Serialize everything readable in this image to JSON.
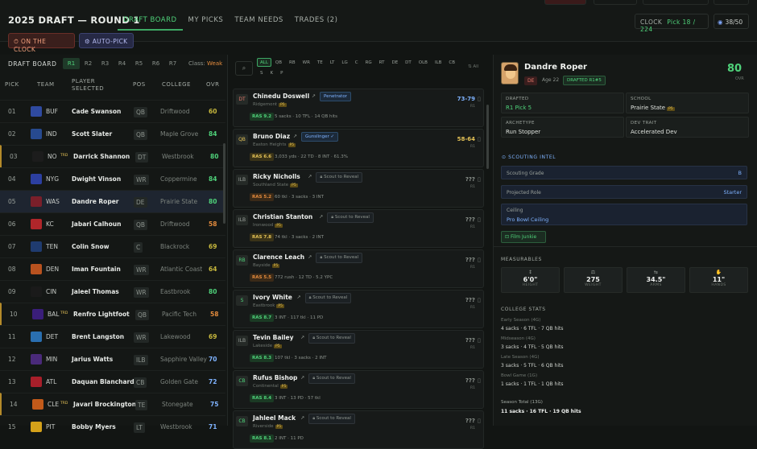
{
  "header": {
    "title": "2025 DRAFT — ROUND 1",
    "tabs": [
      {
        "label": "DRAFT BOARD",
        "active": true
      },
      {
        "label": "MY PICKS",
        "active": false
      },
      {
        "label": "TEAM NEEDS",
        "active": false
      },
      {
        "label": "TRADES (2)",
        "active": false
      }
    ],
    "clock_label": "CLOCK",
    "clock_value": "Pick 18 / 224",
    "presence": "38/50"
  },
  "actions": {
    "on_clock": "ON THE CLOCK",
    "auto_pick": "AUTO-PICK"
  },
  "board": {
    "title": "DRAFT BOARD",
    "rounds": [
      "R1",
      "R2",
      "R3",
      "R4",
      "R5",
      "R6",
      "R7"
    ],
    "active_round": "R1",
    "class_label": "Class:",
    "class_value": "Weak",
    "columns": {
      "pick": "PICK",
      "team": "TEAM",
      "player": "PLAYER\nSELECTED",
      "pos": "POS",
      "college": "COLLEGE",
      "ovr": "OVR"
    },
    "rows": [
      {
        "pick": "01",
        "team": "BUF",
        "logo_color": "#2f4aa0",
        "player": "Cade Swanson",
        "pos": "QB",
        "college": "Driftwood",
        "ovr": "60",
        "ovr_color": "#c7b83d"
      },
      {
        "pick": "02",
        "team": "IND",
        "logo_color": "#274a8f",
        "player": "Scott Slater",
        "pos": "QB",
        "college": "Maple Grove",
        "ovr": "84",
        "ovr_color": "#4fd27a"
      },
      {
        "pick": "03",
        "team": "NO",
        "logo_color": "#1c1c1c",
        "player": "Darrick Shannon",
        "pos": "DT",
        "college": "Westbrook",
        "ovr": "80",
        "ovr_color": "#4fd27a",
        "gold": true,
        "trade": "TRD"
      },
      {
        "pick": "04",
        "team": "NYG",
        "logo_color": "#2c3fa0",
        "player": "Dwight Vinson",
        "pos": "WR",
        "college": "Coppermine",
        "ovr": "84",
        "ovr_color": "#4fd27a"
      },
      {
        "pick": "05",
        "team": "WAS",
        "logo_color": "#7a1f2a",
        "player": "Dandre Roper",
        "pos": "DE",
        "college": "Prairie State",
        "ovr": "80",
        "ovr_color": "#4fd27a",
        "selected": true
      },
      {
        "pick": "06",
        "team": "KC",
        "logo_color": "#b0262a",
        "player": "Jabari Calhoun",
        "pos": "QB",
        "college": "Driftwood",
        "ovr": "58",
        "ovr_color": "#e38b3d"
      },
      {
        "pick": "07",
        "team": "TEN",
        "logo_color": "#1f3b6f",
        "player": "Colin Snow",
        "pos": "C",
        "college": "Blackrock",
        "ovr": "69",
        "ovr_color": "#c7b83d"
      },
      {
        "pick": "08",
        "team": "DEN",
        "logo_color": "#b8521f",
        "player": "Iman Fountain",
        "pos": "WR",
        "college": "Atlantic Coast",
        "ovr": "64",
        "ovr_color": "#c7b83d"
      },
      {
        "pick": "09",
        "team": "CIN",
        "logo_color": "#1a1a1a",
        "player": "Jaleel Thomas",
        "pos": "WR",
        "college": "Eastbrook",
        "ovr": "80",
        "ovr_color": "#4fd27a"
      },
      {
        "pick": "10",
        "team": "BAL",
        "logo_color": "#3a1e7a",
        "player": "Renfro Lightfoot",
        "pos": "QB",
        "college": "Pacific Tech",
        "ovr": "58",
        "ovr_color": "#e38b3d",
        "gold": true,
        "trade": "TRD"
      },
      {
        "pick": "11",
        "team": "DET",
        "logo_color": "#2a6fb0",
        "player": "Brent Langston",
        "pos": "WR",
        "college": "Lakewood",
        "ovr": "69",
        "ovr_color": "#c7b83d"
      },
      {
        "pick": "12",
        "team": "MIN",
        "logo_color": "#4a2a7a",
        "player": "Jarius Watts",
        "pos": "ILB",
        "college": "Sapphire Valley",
        "ovr": "70",
        "ovr_color": "#7fb3ff"
      },
      {
        "pick": "13",
        "team": "ATL",
        "logo_color": "#a81f2a",
        "player": "Daquan Blanchard",
        "pos": "CB",
        "college": "Golden Gate",
        "ovr": "72",
        "ovr_color": "#7fb3ff"
      },
      {
        "pick": "14",
        "team": "CLE",
        "logo_color": "#c25a1a",
        "player": "Javari Brockington",
        "pos": "TE",
        "college": "Stonegate",
        "ovr": "75",
        "ovr_color": "#7fb3ff",
        "gold": true,
        "trade": "TRD"
      },
      {
        "pick": "15",
        "team": "PIT",
        "logo_color": "#d4a11a",
        "player": "Bobby Myers",
        "pos": "LT",
        "college": "Westbrook",
        "ovr": "71",
        "ovr_color": "#7fb3ff"
      }
    ]
  },
  "filters": {
    "positions": [
      "ALL",
      "QB",
      "RB",
      "WR",
      "TE",
      "LT",
      "LG",
      "C",
      "RG",
      "RT",
      "DE",
      "DT",
      "OLB",
      "ILB",
      "CB",
      "S",
      "K",
      "P"
    ],
    "active": "ALL",
    "sort_label": "⇅ All"
  },
  "prospects": [
    {
      "pos": "DT",
      "pos_color": "#e77a6b",
      "name": "Chinedu Doswell",
      "tag": "Penetrator",
      "tag_type": "arch",
      "school": "Ridgemont",
      "ras": "RAS 9.2",
      "ras_bg": "#1b3a24",
      "ras_color": "#4fd27a",
      "stats": "5 sacks · 10 TFL · 14 QB hits",
      "grade": "73-79",
      "grade_color": "#7fb3ff",
      "round": "R1"
    },
    {
      "pos": "QB",
      "pos_color": "#e5c357",
      "name": "Bruno Diaz",
      "tag": "Gunslinger ✓",
      "tag_type": "arch",
      "school": "Easton Heights",
      "ras": "RAS 6.6",
      "ras_bg": "#3a3318",
      "ras_color": "#e5c357",
      "stats": "3,033 yds · 22 TD · 8 INT · 61.3%",
      "grade": "58-64",
      "grade_color": "#e5c357",
      "round": "R1"
    },
    {
      "pos": "ILB",
      "pos_color": "#9aa19b",
      "name": "Ricky Nicholls",
      "tag": "Scout to Reveal",
      "tag_type": "rev",
      "school": "Southland State",
      "ras": "RAS 5.2",
      "ras_bg": "#3a2a18",
      "ras_color": "#e38b3d",
      "stats": "60 tkl · 3 sacks · 3 INT",
      "grade": "???",
      "grade_color": "#8d948e",
      "round": "R1"
    },
    {
      "pos": "ILB",
      "pos_color": "#9aa19b",
      "name": "Christian Stanton",
      "tag": "Scout to Reveal",
      "tag_type": "rev",
      "school": "Ironwood",
      "ras": "RAS 7.8",
      "ras_bg": "#3a3318",
      "ras_color": "#e5c357",
      "stats": "74 tkl · 3 sacks · 2 INT",
      "grade": "???",
      "grade_color": "#8d948e",
      "round": "R1"
    },
    {
      "pos": "RB",
      "pos_color": "#4fd27a",
      "name": "Clarence Leach",
      "tag": "Scout to Reveal",
      "tag_type": "rev",
      "school": "Bayside",
      "ras": "RAS 5.5",
      "ras_bg": "#3a2a18",
      "ras_color": "#e38b3d",
      "stats": "772 rush · 12 TD · 5.2 YPC",
      "grade": "???",
      "grade_color": "#8d948e",
      "round": "R1"
    },
    {
      "pos": "S",
      "pos_color": "#4fd27a",
      "name": "Ivory White",
      "tag": "Scout to Reveal",
      "tag_type": "rev",
      "school": "Eastbrook",
      "ras": "RAS 8.7",
      "ras_bg": "#1b3a24",
      "ras_color": "#4fd27a",
      "stats": "3 INT · 117 tkl · 11 PD",
      "grade": "???",
      "grade_color": "#8d948e",
      "round": "R1"
    },
    {
      "pos": "ILB",
      "pos_color": "#9aa19b",
      "name": "Tevin Bailey",
      "tag": "Scout to Reveal",
      "tag_type": "rev",
      "school": "Lakeside",
      "ras": "RAS 8.3",
      "ras_bg": "#1b3a24",
      "ras_color": "#4fd27a",
      "stats": "107 tkl · 3 sacks · 2 INT",
      "grade": "???",
      "grade_color": "#8d948e",
      "round": "R1"
    },
    {
      "pos": "CB",
      "pos_color": "#4fd27a",
      "name": "Rufus Bishop",
      "tag": "Scout to Reveal",
      "tag_type": "rev",
      "school": "Continental",
      "ras": "RAS 8.4",
      "ras_bg": "#1b3a24",
      "ras_color": "#4fd27a",
      "stats": "3 INT · 13 PD · 57 tkl",
      "grade": "???",
      "grade_color": "#8d948e",
      "round": "R1"
    },
    {
      "pos": "CB",
      "pos_color": "#4fd27a",
      "name": "Jahleel Mack",
      "tag": "Scout to Reveal",
      "tag_type": "rev",
      "school": "Riverside",
      "ras": "RAS 8.1",
      "ras_bg": "#1b3a24",
      "ras_color": "#4fd27a",
      "stats": "2 INT · 11 PD",
      "grade": "???",
      "grade_color": "#8d948e",
      "round": "R1"
    }
  ],
  "player": {
    "name": "Dandre Roper",
    "pos": "DE",
    "age": "Age 22",
    "drafted_badge": "DRAFTED R1#5",
    "ovr": "80",
    "ovr_label": "OVR",
    "drafted_label": "DRAFTED",
    "drafted_value": "R1 Pick 5",
    "school_label": "SCHOOL",
    "school_value": "Prairie State",
    "archetype_label": "ARCHETYPE",
    "archetype_value": "Run Stopper",
    "devtrait_label": "DEV TRAIT",
    "devtrait_value": "Accelerated Dev",
    "intel_title": "SCOUTING INTEL",
    "grade_label": "Scouting Grade",
    "grade_value": "B",
    "role_label": "Projected Role",
    "role_value": "Starter",
    "ceiling_label": "Ceiling",
    "ceiling_value": "Pro Bowl Ceiling",
    "trait": "Film Junkie",
    "measurables_title": "MEASURABLES",
    "measurables": [
      {
        "icon": "↕",
        "value": "6'0\"",
        "label": "HEIGHT"
      },
      {
        "icon": "⚖",
        "value": "275",
        "label": "WEIGHT"
      },
      {
        "icon": "⇆",
        "value": "34.5\"",
        "label": "ARMS"
      },
      {
        "icon": "✋",
        "value": "11\"",
        "label": "HANDS"
      }
    ],
    "stats_title": "COLLEGE STATS",
    "stats": [
      {
        "period": "Early Season (4G)",
        "line": "4 sacks · 6 TFL · 7 QB hits"
      },
      {
        "period": "Midseason (4G)",
        "line": "3 sacks · 4 TFL · 5 QB hits"
      },
      {
        "period": "Late Season (4G)",
        "line": "3 sacks · 5 TFL · 6 QB hits"
      },
      {
        "period": "Bowl Game (1G)",
        "line": "1 sacks · 1 TFL · 1 QB hits"
      }
    ],
    "total_label": "Season Total (13G)",
    "total_value": "11 sacks · 16 TFL · 19 QB hits"
  }
}
